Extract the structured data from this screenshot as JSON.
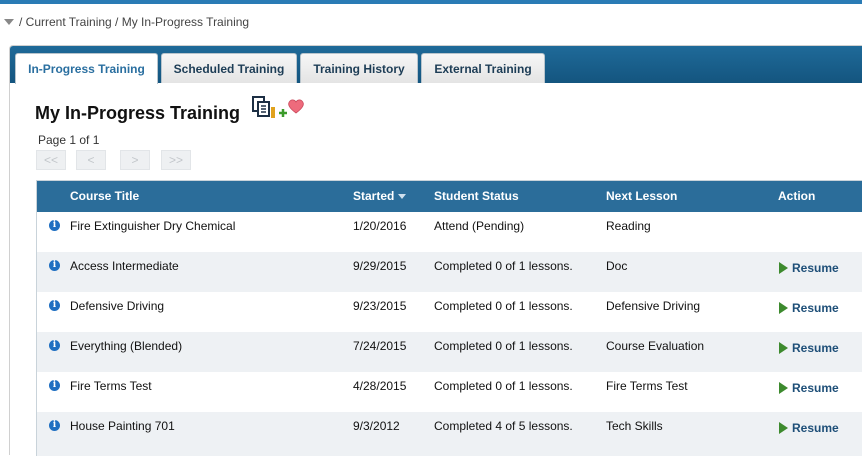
{
  "breadcrumb": {
    "text": "/ Current Training / My In-Progress Training"
  },
  "tabs": [
    {
      "label": "In-Progress Training",
      "active": true
    },
    {
      "label": "Scheduled Training",
      "active": false
    },
    {
      "label": "Training History",
      "active": false
    },
    {
      "label": "External Training",
      "active": false
    }
  ],
  "page": {
    "title": "My In-Progress Training",
    "pagination_info": "Page 1 of 1"
  },
  "pager": {
    "first": "<<",
    "prev": "<",
    "next": ">",
    "last": ">>"
  },
  "icons": {
    "info": "info-icon",
    "play": "play-icon",
    "copy": "copy-icon",
    "favorite": "add-favorite-icon"
  },
  "colors": {
    "header": "#2b6d9a",
    "tabbar": "#1f6a99",
    "accent": "#2a6fa0",
    "play": "#3d8a2e"
  },
  "table": {
    "headers": {
      "title": "Course Title",
      "started": "Started",
      "status": "Student Status",
      "next": "Next Lesson",
      "action": "Action"
    },
    "rows": [
      {
        "title": "Fire Extinguisher Dry Chemical",
        "started": "1/20/2016",
        "status": "Attend (Pending)",
        "next": "Reading",
        "action": ""
      },
      {
        "title": "Access Intermediate",
        "started": "9/29/2015",
        "status": "Completed 0 of 1 lessons.",
        "next": "Doc",
        "action": "Resume"
      },
      {
        "title": "Defensive Driving",
        "started": "9/23/2015",
        "status": "Completed 0 of 1 lessons.",
        "next": "Defensive Driving",
        "action": "Resume"
      },
      {
        "title": "Everything (Blended)",
        "started": "7/24/2015",
        "status": "Completed 0 of 1 lessons.",
        "next": "Course Evaluation",
        "action": "Resume"
      },
      {
        "title": "Fire Terms Test",
        "started": "4/28/2015",
        "status": "Completed 0 of 1 lessons.",
        "next": "Fire Terms Test",
        "action": "Resume"
      },
      {
        "title": "House Painting 701",
        "started": "9/3/2012",
        "status": "Completed 4 of 5 lessons.",
        "next": "Tech Skills",
        "action": "Resume"
      }
    ]
  }
}
